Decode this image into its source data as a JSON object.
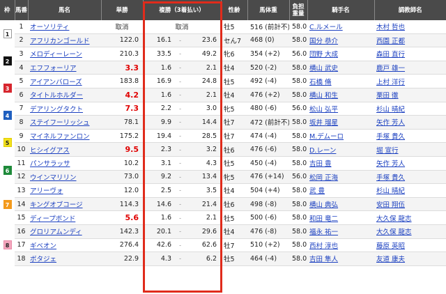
{
  "headers": {
    "waku": "枠",
    "umaban": "馬番",
    "name": "馬名",
    "win": "単勝",
    "place": "複勝（3着払い）",
    "sexage": "性齢",
    "bodyweight": "馬体重",
    "kinryo": "負担重量",
    "jockey": "騎手名",
    "trainer": "調教師名"
  },
  "cancel_label": "取消",
  "place_dash": "-",
  "waku_colors": {
    "1": {
      "bg": "#ffffff",
      "fg": "#222222",
      "border": "#999999"
    },
    "2": {
      "bg": "#111111",
      "fg": "#ffffff",
      "border": "#111111"
    },
    "3": {
      "bg": "#d7262e",
      "fg": "#ffffff",
      "border": "#d7262e"
    },
    "4": {
      "bg": "#1f5fbf",
      "fg": "#ffffff",
      "border": "#1f5fbf"
    },
    "5": {
      "bg": "#f3e21c",
      "fg": "#222222",
      "border": "#e0cc00"
    },
    "6": {
      "bg": "#1e8a3a",
      "fg": "#ffffff",
      "border": "#1e8a3a"
    },
    "7": {
      "bg": "#f39a1c",
      "fg": "#ffffff",
      "border": "#f39a1c"
    },
    "8": {
      "bg": "#f4a7be",
      "fg": "#222222",
      "border": "#e98aa7"
    }
  },
  "wakus": [
    {
      "waku": "1",
      "span": 2
    },
    {
      "waku": "2",
      "span": 2
    },
    {
      "waku": "3",
      "span": 2
    },
    {
      "waku": "4",
      "span": 2
    },
    {
      "waku": "5",
      "span": 2
    },
    {
      "waku": "6",
      "span": 2
    },
    {
      "waku": "7",
      "span": 3
    },
    {
      "waku": "8",
      "span": 3
    }
  ],
  "rows": [
    {
      "umaban": "1",
      "name": "オーソリティ",
      "win": "",
      "fav": false,
      "cancel": true,
      "place_lo": "",
      "place_hi": "",
      "sexage": "牡5",
      "bodyweight": "516 (前計不)",
      "kinryo": "58.0",
      "jockey": "C.ルメール",
      "trainer": "木村 哲也"
    },
    {
      "umaban": "2",
      "name": "アフリカンゴールド",
      "win": "122.0",
      "fav": false,
      "cancel": false,
      "place_lo": "16.1",
      "place_hi": "23.6",
      "sexage": "セん7",
      "bodyweight": "468 (0)",
      "kinryo": "58.0",
      "jockey": "国分 恭介",
      "trainer": "西園 正都"
    },
    {
      "umaban": "3",
      "name": "メロディーレーン",
      "win": "210.3",
      "fav": false,
      "cancel": false,
      "place_lo": "33.5",
      "place_hi": "49.2",
      "sexage": "牝6",
      "bodyweight": "354 (+2)",
      "kinryo": "56.0",
      "jockey": "団野 大成",
      "trainer": "森田 直行"
    },
    {
      "umaban": "4",
      "name": "エフフォーリア",
      "win": "3.3",
      "fav": true,
      "cancel": false,
      "place_lo": "1.6",
      "place_hi": "2.1",
      "sexage": "牡4",
      "bodyweight": "520 (-2)",
      "kinryo": "58.0",
      "jockey": "横山 武史",
      "trainer": "鹿戸 雄一"
    },
    {
      "umaban": "5",
      "name": "アイアンバローズ",
      "win": "183.8",
      "fav": false,
      "cancel": false,
      "place_lo": "16.9",
      "place_hi": "24.8",
      "sexage": "牡5",
      "bodyweight": "492 (-4)",
      "kinryo": "58.0",
      "jockey": "石橋 脩",
      "trainer": "上村 洋行"
    },
    {
      "umaban": "6",
      "name": "タイトルホルダー",
      "win": "4.2",
      "fav": true,
      "cancel": false,
      "place_lo": "1.6",
      "place_hi": "2.1",
      "sexage": "牡4",
      "bodyweight": "476 (+2)",
      "kinryo": "58.0",
      "jockey": "横山 和生",
      "trainer": "栗田 徹"
    },
    {
      "umaban": "7",
      "name": "デアリングタクト",
      "win": "7.3",
      "fav": true,
      "cancel": false,
      "place_lo": "2.2",
      "place_hi": "3.0",
      "sexage": "牝5",
      "bodyweight": "480 (-6)",
      "kinryo": "56.0",
      "jockey": "松山 弘平",
      "trainer": "杉山 晴紀"
    },
    {
      "umaban": "8",
      "name": "ステイフーリッシュ",
      "win": "78.1",
      "fav": false,
      "cancel": false,
      "place_lo": "9.9",
      "place_hi": "14.4",
      "sexage": "牡7",
      "bodyweight": "472 (前計不)",
      "kinryo": "58.0",
      "jockey": "坂井 瑠星",
      "trainer": "矢作 芳人"
    },
    {
      "umaban": "9",
      "name": "マイネルファンロン",
      "win": "175.2",
      "fav": false,
      "cancel": false,
      "place_lo": "19.4",
      "place_hi": "28.5",
      "sexage": "牡7",
      "bodyweight": "474 (-4)",
      "kinryo": "58.0",
      "jockey": "M.デムーロ",
      "trainer": "手塚 貴久"
    },
    {
      "umaban": "10",
      "name": "ヒシイグアス",
      "win": "9.5",
      "fav": true,
      "cancel": false,
      "place_lo": "2.3",
      "place_hi": "3.2",
      "sexage": "牡6",
      "bodyweight": "476 (-6)",
      "kinryo": "58.0",
      "jockey": "D.レーン",
      "trainer": "堀 宣行"
    },
    {
      "umaban": "11",
      "name": "パンサラッサ",
      "win": "10.2",
      "fav": false,
      "cancel": false,
      "place_lo": "3.1",
      "place_hi": "4.3",
      "sexage": "牡5",
      "bodyweight": "450 (-4)",
      "kinryo": "58.0",
      "jockey": "吉田 豊",
      "trainer": "矢作 芳人"
    },
    {
      "umaban": "12",
      "name": "ウインマリリン",
      "win": "73.0",
      "fav": false,
      "cancel": false,
      "place_lo": "9.2",
      "place_hi": "13.4",
      "sexage": "牝5",
      "bodyweight": "476 (+14)",
      "kinryo": "56.0",
      "jockey": "松岡 正海",
      "trainer": "手塚 貴久"
    },
    {
      "umaban": "13",
      "name": "アリーヴォ",
      "win": "12.0",
      "fav": false,
      "cancel": false,
      "place_lo": "2.5",
      "place_hi": "3.5",
      "sexage": "牡4",
      "bodyweight": "504 (+4)",
      "kinryo": "58.0",
      "jockey": "武 豊",
      "trainer": "杉山 晴紀"
    },
    {
      "umaban": "14",
      "name": "キングオブコージ",
      "win": "114.3",
      "fav": false,
      "cancel": false,
      "place_lo": "14.6",
      "place_hi": "21.4",
      "sexage": "牡6",
      "bodyweight": "498 (-8)",
      "kinryo": "58.0",
      "jockey": "横山 典弘",
      "trainer": "安田 翔伍"
    },
    {
      "umaban": "15",
      "name": "ディープボンド",
      "win": "5.6",
      "fav": true,
      "cancel": false,
      "place_lo": "1.6",
      "place_hi": "2.1",
      "sexage": "牡5",
      "bodyweight": "500 (-6)",
      "kinryo": "58.0",
      "jockey": "和田 竜二",
      "trainer": "大久保 龍志"
    },
    {
      "umaban": "16",
      "name": "グロリアムンディ",
      "win": "142.3",
      "fav": false,
      "cancel": false,
      "place_lo": "20.1",
      "place_hi": "29.6",
      "sexage": "牡4",
      "bodyweight": "476 (-8)",
      "kinryo": "58.0",
      "jockey": "福永 祐一",
      "trainer": "大久保 龍志"
    },
    {
      "umaban": "17",
      "name": "ギベオン",
      "win": "276.4",
      "fav": false,
      "cancel": false,
      "place_lo": "42.6",
      "place_hi": "62.6",
      "sexage": "牡7",
      "bodyweight": "510 (+2)",
      "kinryo": "58.0",
      "jockey": "西村 淳也",
      "trainer": "藤原 英昭"
    },
    {
      "umaban": "18",
      "name": "ボタジェ",
      "win": "22.9",
      "fav": false,
      "cancel": false,
      "place_lo": "4.3",
      "place_hi": "6.2",
      "sexage": "牡5",
      "bodyweight": "464 (-4)",
      "kinryo": "58.0",
      "jockey": "吉田 隼人",
      "trainer": "友道 康夫"
    }
  ]
}
